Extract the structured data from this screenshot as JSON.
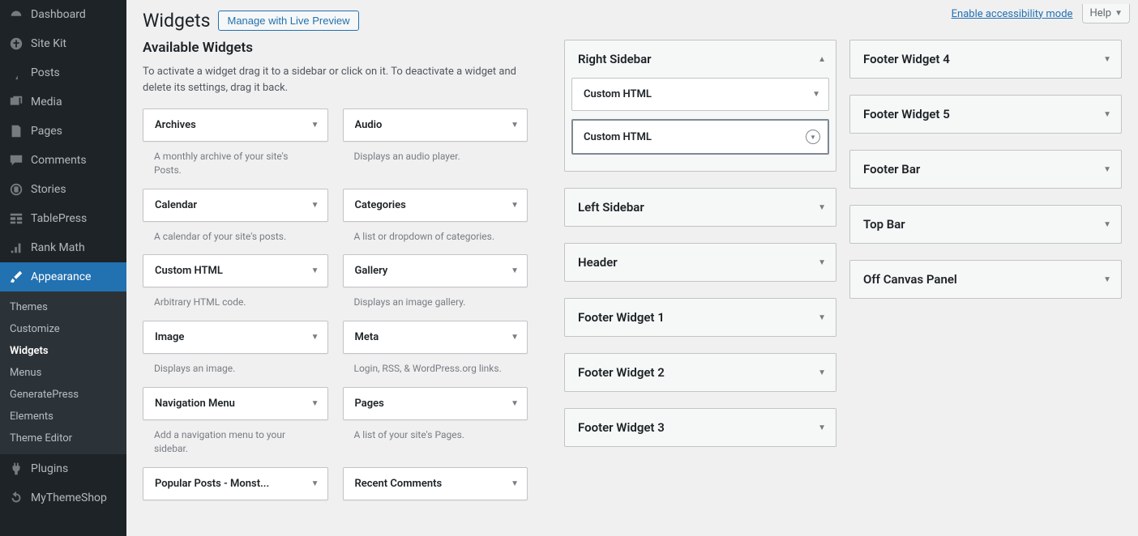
{
  "topbar": {
    "accessibility_link": "Enable accessibility mode",
    "help_label": "Help"
  },
  "page": {
    "title": "Widgets",
    "manage_button": "Manage with Live Preview",
    "available_heading": "Available Widgets",
    "available_desc": "To activate a widget drag it to a sidebar or click on it. To deactivate a widget and delete its settings, drag it back."
  },
  "admin_menu": [
    {
      "label": "Dashboard",
      "icon": "dashboard"
    },
    {
      "label": "Site Kit",
      "icon": "sitekit"
    },
    {
      "label": "Posts",
      "icon": "pin"
    },
    {
      "label": "Media",
      "icon": "media"
    },
    {
      "label": "Pages",
      "icon": "page"
    },
    {
      "label": "Comments",
      "icon": "comment"
    },
    {
      "label": "Stories",
      "icon": "story"
    },
    {
      "label": "TablePress",
      "icon": "table"
    },
    {
      "label": "Rank Math",
      "icon": "rankmath"
    },
    {
      "label": "Appearance",
      "icon": "brush",
      "current": true
    },
    {
      "label": "Plugins",
      "icon": "plugin"
    },
    {
      "label": "MyThemeShop",
      "icon": "refresh"
    }
  ],
  "appearance_submenu": [
    {
      "label": "Themes"
    },
    {
      "label": "Customize"
    },
    {
      "label": "Widgets",
      "current": true
    },
    {
      "label": "Menus"
    },
    {
      "label": "GeneratePress"
    },
    {
      "label": "Elements"
    },
    {
      "label": "Theme Editor"
    }
  ],
  "available_widgets": [
    {
      "title": "Archives",
      "desc": "A monthly archive of your site's Posts."
    },
    {
      "title": "Audio",
      "desc": "Displays an audio player."
    },
    {
      "title": "Calendar",
      "desc": "A calendar of your site's posts."
    },
    {
      "title": "Categories",
      "desc": "A list or dropdown of categories."
    },
    {
      "title": "Custom HTML",
      "desc": "Arbitrary HTML code."
    },
    {
      "title": "Gallery",
      "desc": "Displays an image gallery."
    },
    {
      "title": "Image",
      "desc": "Displays an image."
    },
    {
      "title": "Meta",
      "desc": "Login, RSS, & WordPress.org links."
    },
    {
      "title": "Navigation Menu",
      "desc": "Add a navigation menu to your sidebar."
    },
    {
      "title": "Pages",
      "desc": "A list of your site's Pages."
    },
    {
      "title": "Popular Posts - Monst...",
      "desc": ""
    },
    {
      "title": "Recent Comments",
      "desc": ""
    }
  ],
  "sidebar_areas_left": [
    {
      "name": "Right Sidebar",
      "expanded": true,
      "widgets": [
        {
          "title": "Custom HTML"
        },
        {
          "title": "Custom HTML",
          "highlighted": true
        }
      ]
    },
    {
      "name": "Left Sidebar"
    },
    {
      "name": "Header"
    },
    {
      "name": "Footer Widget 1"
    },
    {
      "name": "Footer Widget 2"
    },
    {
      "name": "Footer Widget 3"
    }
  ],
  "sidebar_areas_right": [
    {
      "name": "Footer Widget 4"
    },
    {
      "name": "Footer Widget 5"
    },
    {
      "name": "Footer Bar"
    },
    {
      "name": "Top Bar"
    },
    {
      "name": "Off Canvas Panel"
    }
  ]
}
